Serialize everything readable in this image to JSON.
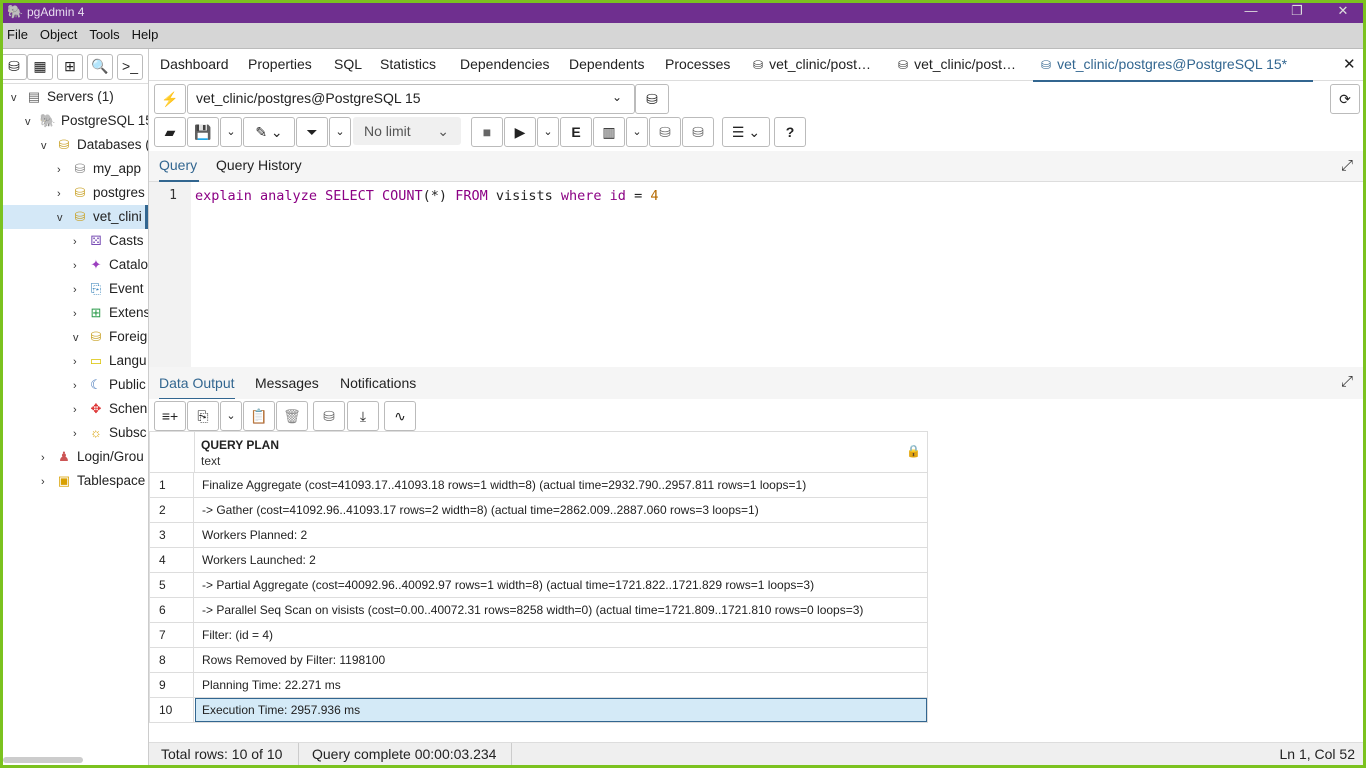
{
  "app": {
    "title": "pgAdmin 4"
  },
  "menu": [
    "File",
    "Object",
    "Tools",
    "Help"
  ],
  "sidebar": {
    "tree": [
      {
        "label": "Servers (1)",
        "icon": "server-group-icon"
      },
      {
        "label": "PostgreSQL 15",
        "icon": "postgres-elephant-icon"
      },
      {
        "label": "Databases (",
        "icon": "databases-icon"
      },
      {
        "label": "my_app",
        "icon": "database-disconnected-icon"
      },
      {
        "label": "postgres",
        "icon": "database-icon"
      },
      {
        "label": "vet_clini",
        "icon": "database-icon"
      },
      {
        "label": "Casts",
        "icon": "casts-icon"
      },
      {
        "label": "Catalo",
        "icon": "catalogs-icon"
      },
      {
        "label": "Event",
        "icon": "event-trigger-icon"
      },
      {
        "label": "Extens",
        "icon": "extensions-icon"
      },
      {
        "label": "Foreig",
        "icon": "foreign-data-icon"
      },
      {
        "label": "Langu",
        "icon": "languages-icon"
      },
      {
        "label": "Public",
        "icon": "publications-icon"
      },
      {
        "label": "Schen",
        "icon": "schemas-icon"
      },
      {
        "label": "Subsc",
        "icon": "subscriptions-icon"
      },
      {
        "label": "Login/Grou",
        "icon": "login-roles-icon"
      },
      {
        "label": "Tablespace",
        "icon": "tablespaces-icon"
      }
    ]
  },
  "tabs": [
    {
      "label": "Dashboard"
    },
    {
      "label": "Properties"
    },
    {
      "label": "SQL"
    },
    {
      "label": "Statistics"
    },
    {
      "label": "Dependencies"
    },
    {
      "label": "Dependents"
    },
    {
      "label": "Processes"
    },
    {
      "label": "vet_clinic/post…"
    },
    {
      "label": "vet_clinic/post…"
    },
    {
      "label": "vet_clinic/postgres@PostgreSQL 15*"
    }
  ],
  "connection": {
    "value": "vet_clinic/postgres@PostgreSQL 15"
  },
  "toolbar": {
    "limit_label": "No limit"
  },
  "query_tabs": [
    "Query",
    "Query History"
  ],
  "editor": {
    "line_number": "1",
    "tokens": {
      "explain": "explain",
      "analyze": "analyze",
      "select": "SELECT",
      "count": "COUNT",
      "paren": "(*)",
      "from": "FROM",
      "table": "visists",
      "where": "where",
      "col": "id",
      "eq": "=",
      "val": "4"
    }
  },
  "result_tabs": [
    "Data Output",
    "Messages",
    "Notifications"
  ],
  "grid": {
    "column_name": "QUERY PLAN",
    "column_type": "text",
    "rows": [
      {
        "n": "1",
        "text": "Finalize Aggregate (cost=41093.17..41093.18 rows=1 width=8) (actual time=2932.790..2957.811 rows=1 loops=1)"
      },
      {
        "n": "2",
        "text": "-> Gather (cost=41092.96..41093.17 rows=2 width=8) (actual time=2862.009..2887.060 rows=3 loops=1)"
      },
      {
        "n": "3",
        "text": "Workers Planned: 2"
      },
      {
        "n": "4",
        "text": "Workers Launched: 2"
      },
      {
        "n": "5",
        "text": "-> Partial Aggregate (cost=40092.96..40092.97 rows=1 width=8) (actual time=1721.822..1721.829 rows=1 loops=3)"
      },
      {
        "n": "6",
        "text": "-> Parallel Seq Scan on visists (cost=0.00..40072.31 rows=8258 width=0) (actual time=1721.809..1721.810 rows=0 loops=3)"
      },
      {
        "n": "7",
        "text": "Filter: (id = 4)"
      },
      {
        "n": "8",
        "text": "Rows Removed by Filter: 1198100"
      },
      {
        "n": "9",
        "text": "Planning Time: 22.271 ms"
      },
      {
        "n": "10",
        "text": "Execution Time: 2957.936 ms"
      }
    ]
  },
  "status": {
    "total_rows": "Total rows: 10 of 10",
    "query_complete": "Query complete 00:00:03.234",
    "cursor": "Ln 1, Col 52"
  }
}
